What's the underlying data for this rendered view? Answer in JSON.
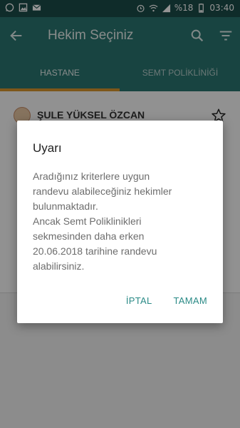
{
  "status_bar": {
    "battery": "%18",
    "time": "03:40",
    "left_icons": [
      "whatsapp-icon",
      "gallery-icon",
      "mail-icon"
    ],
    "right_icons": [
      "alarm-icon",
      "wifi-icon",
      "signal-icon",
      "battery-icon"
    ]
  },
  "app_bar": {
    "title": "Hekim Seçiniz",
    "icons": [
      "back-arrow-icon",
      "search-icon",
      "filter-icon"
    ]
  },
  "tabs": [
    {
      "label": "HASTANE",
      "selected": true
    },
    {
      "label": "SEMT POLİKLİNİĞİ",
      "selected": false
    }
  ],
  "list": {
    "items": [
      {
        "name": "ŞULE YÜKSEL ÖZCAN",
        "icon": "star-outline-icon"
      }
    ]
  },
  "dialog": {
    "title": "Uyarı",
    "message_lines": [
      "Aradığınız kriterlere uygun",
      "randevu alabileceğiniz hekimler",
      "bulunmaktadır.",
      "Ancak Semt Poliklinikleri",
      "sekmesinden daha erken",
      "20.06.2018 tarihine randevu",
      "alabilirsiniz."
    ],
    "cancel_label": "İPTAL",
    "ok_label": "TAMAM"
  },
  "colors": {
    "primary": "#2a7670",
    "status_bar": "#1b4d49",
    "tab_indicator": "#d9962b",
    "accent": "#2a8a86"
  }
}
